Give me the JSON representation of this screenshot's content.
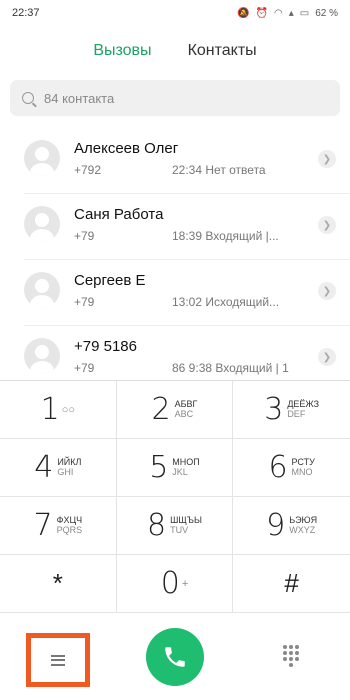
{
  "status_bar": {
    "time": "22:37",
    "battery": "62 %",
    "icons": [
      "mute-icon",
      "alarm-icon",
      "wifi-icon",
      "signal-icon",
      "battery-icon"
    ]
  },
  "tabs": {
    "calls": "Вызовы",
    "contacts": "Контакты"
  },
  "search": {
    "placeholder": "84 контакта"
  },
  "calls": [
    {
      "name": "Алексеев Олег",
      "number": "+792",
      "time": "22:34",
      "status": "Нет ответа"
    },
    {
      "name": "Саня Работа",
      "number": "+79",
      "time": "18:39",
      "status": "Входящий |..."
    },
    {
      "name": "Сергеев Е",
      "number": "+79",
      "time": "13:02",
      "status": "Исходящий..."
    },
    {
      "name": "+79       5186",
      "number": "+79",
      "time": "86 9:38",
      "status": "Входящий | 1"
    }
  ],
  "keypad": [
    {
      "digit": "1",
      "cyr": "",
      "lat": ""
    },
    {
      "digit": "2",
      "cyr": "АБВГ",
      "lat": "ABC"
    },
    {
      "digit": "3",
      "cyr": "ДЕЁЖЗ",
      "lat": "DEF"
    },
    {
      "digit": "4",
      "cyr": "ИЙКЛ",
      "lat": "GHI"
    },
    {
      "digit": "5",
      "cyr": "МНОП",
      "lat": "JKL"
    },
    {
      "digit": "6",
      "cyr": "РСТУ",
      "lat": "MNO"
    },
    {
      "digit": "7",
      "cyr": "ФХЦЧ",
      "lat": "PQRS"
    },
    {
      "digit": "8",
      "cyr": "ШЩЪЫ",
      "lat": "TUV"
    },
    {
      "digit": "9",
      "cyr": "ЬЭЮЯ",
      "lat": "WXYZ"
    },
    {
      "digit": "*",
      "cyr": "",
      "lat": ""
    },
    {
      "digit": "0",
      "cyr": "+",
      "lat": ""
    },
    {
      "digit": "#",
      "cyr": "",
      "lat": ""
    }
  ],
  "colors": {
    "accent": "#1aa364",
    "call_button": "#1ebd6f",
    "highlight": "#f05a22"
  }
}
